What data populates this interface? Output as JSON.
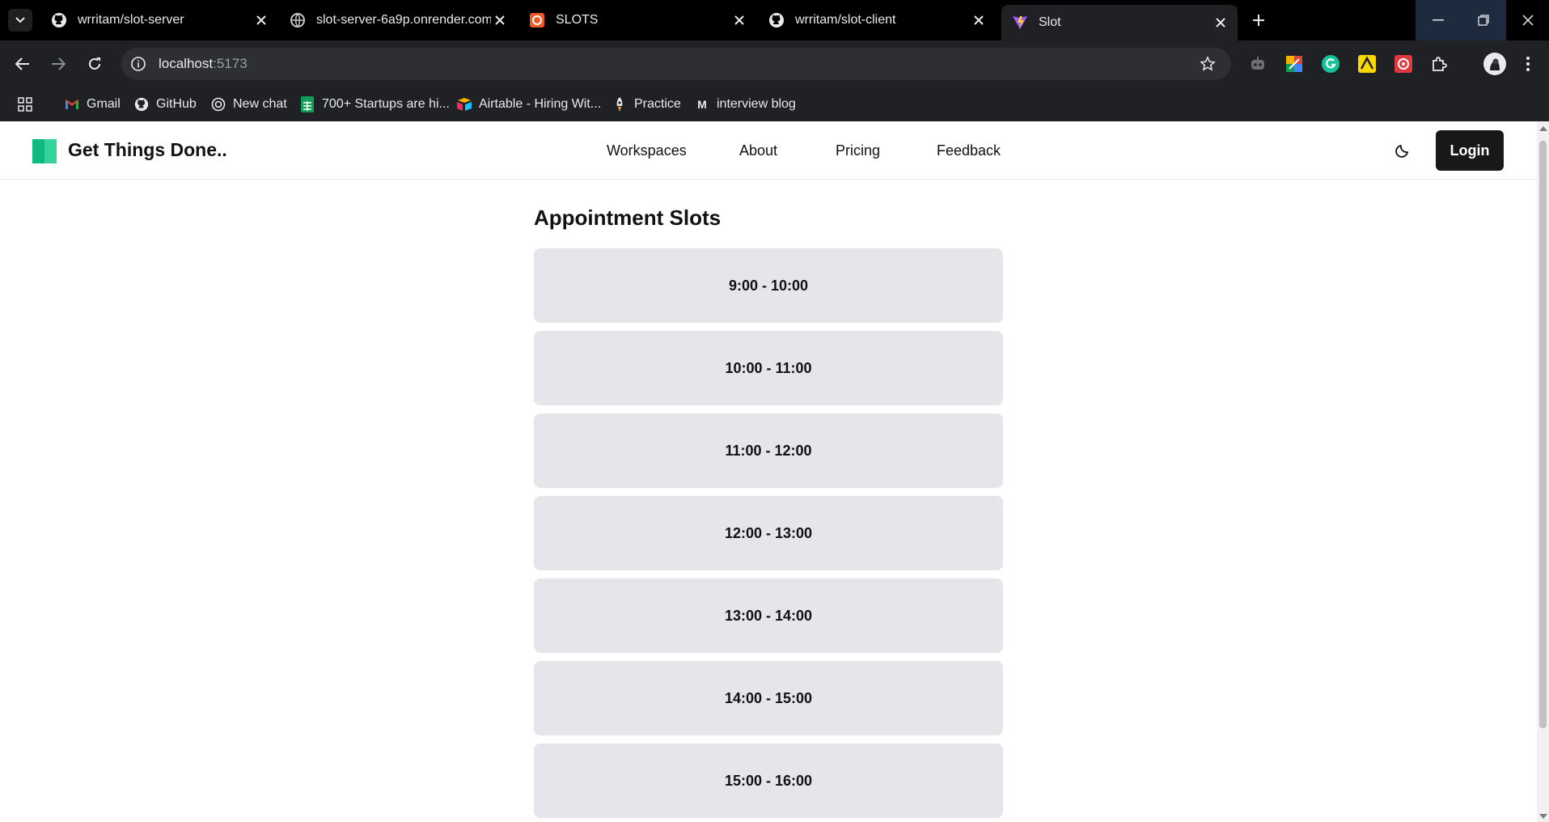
{
  "browser": {
    "tabs": [
      {
        "title": "wrritam/slot-server",
        "icon": "github-icon",
        "active": false
      },
      {
        "title": "slot-server-6a9p.onrender.com/",
        "icon": "globe-icon",
        "active": false
      },
      {
        "title": "SLOTS",
        "icon": "postman-icon",
        "active": false
      },
      {
        "title": "wrritam/slot-client",
        "icon": "github-icon",
        "active": false
      },
      {
        "title": "Slot",
        "icon": "vite-icon",
        "active": true
      }
    ],
    "url_host": "localhost",
    "url_port": ":5173",
    "bookmarks": [
      {
        "label": "Gmail",
        "icon": "gmail-icon"
      },
      {
        "label": "GitHub",
        "icon": "github-icon"
      },
      {
        "label": "New chat",
        "icon": "chatgpt-icon"
      },
      {
        "label": "700+ Startups are hi...",
        "icon": "sheets-icon"
      },
      {
        "label": "Airtable - Hiring Wit...",
        "icon": "airtable-icon"
      },
      {
        "label": "Practice",
        "icon": "rocket-icon"
      },
      {
        "label": "interview blog",
        "icon": "medium-icon"
      }
    ]
  },
  "site": {
    "brand": "Get Things Done..",
    "nav": [
      {
        "label": "Workspaces"
      },
      {
        "label": "About"
      },
      {
        "label": "Pricing"
      },
      {
        "label": "Feedback"
      }
    ],
    "login_label": "Login",
    "theme_icon": "moon-icon"
  },
  "main": {
    "heading": "Appointment Slots",
    "slots": [
      {
        "label": "9:00 - 10:00"
      },
      {
        "label": "10:00 - 11:00"
      },
      {
        "label": "11:00 - 12:00"
      },
      {
        "label": "12:00 - 13:00"
      },
      {
        "label": "13:00 - 14:00"
      },
      {
        "label": "14:00 - 15:00"
      },
      {
        "label": "15:00 - 16:00"
      }
    ]
  },
  "colors": {
    "brand_green": "#10b981",
    "login_bg": "#18181b",
    "slot_bg": "#e5e6ea"
  }
}
